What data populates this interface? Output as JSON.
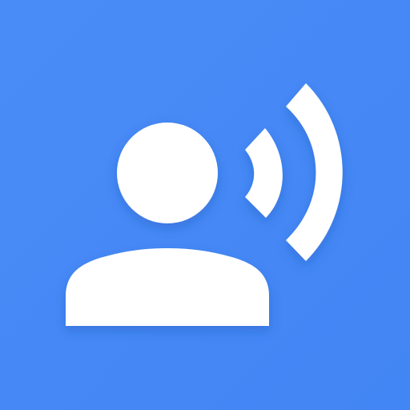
{
  "app_icon": {
    "name": "speaking-person-icon",
    "background_color": "#4285F4",
    "background_highlight": "#4A8CF7",
    "glyph_color": "#FFFFFF",
    "shadow_color": "#1A4FB0",
    "parts": [
      "person-head",
      "person-shoulders",
      "sound-wave-small",
      "sound-wave-large"
    ]
  }
}
